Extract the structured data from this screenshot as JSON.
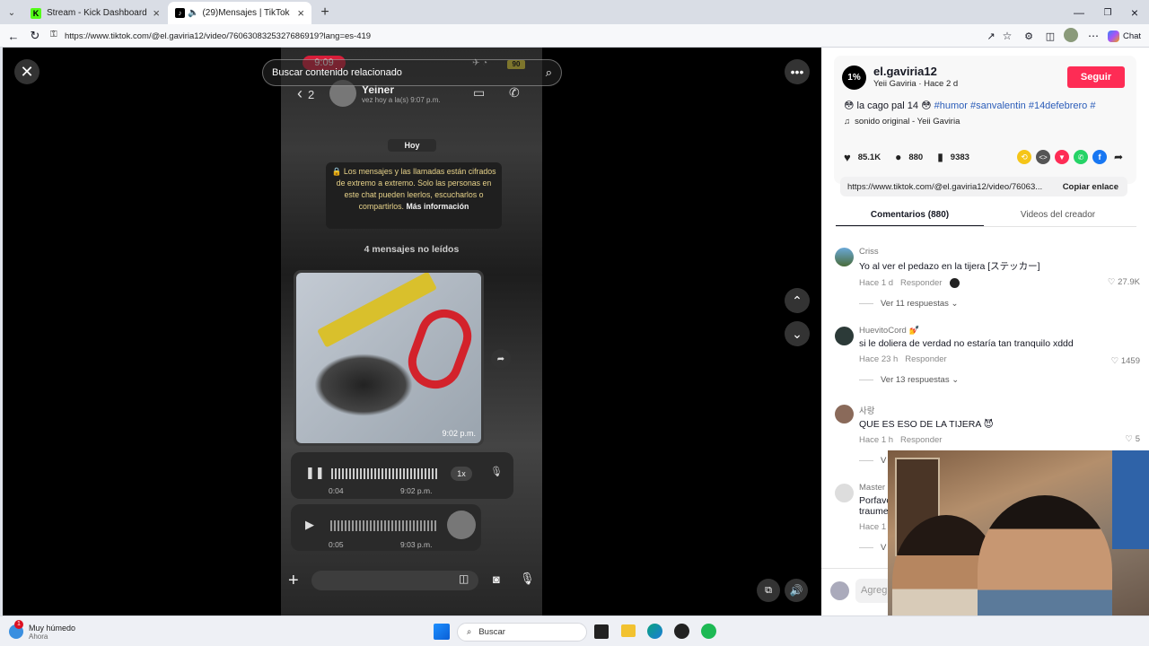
{
  "browser": {
    "tabs": [
      {
        "label": "Stream - Kick Dashboard",
        "active": false
      },
      {
        "label": "(29)Mensajes | TikTok",
        "active": true
      }
    ],
    "url": "https://www.tiktok.com/@el.gaviria12/video/7606308325327686919?lang=es-419",
    "chat_label": "Chat"
  },
  "player": {
    "search_placeholder": "Buscar contenido relacionado",
    "phone": {
      "time": "9:09",
      "battery": "90",
      "back_count": "2",
      "contact_name": "Yeiner",
      "contact_status": "vez hoy a la(s) 9:07 p.m.",
      "date_chip": "Hoy",
      "encryption_note": "Los mensajes y las llamadas están cifrados de extremo a extremo. Solo las personas en este chat pueden leerlos, escucharlos o compartirlos.",
      "encryption_link": "Más información",
      "unread": "4 mensajes no leídos",
      "image_time": "9:02 p.m.",
      "audio1": {
        "elapsed": "0:04",
        "time": "9:02 p.m.",
        "speed": "1x"
      },
      "audio2": {
        "elapsed": "0:05",
        "time": "9:03 p.m."
      }
    }
  },
  "post": {
    "avatar_text": "1%",
    "username": "el.gaviria12",
    "display_name": "Yeii Gaviria",
    "age": "Hace 2 d",
    "follow_label": "Seguir",
    "caption_text": "la cago pal 14",
    "hashtags": [
      "#humor",
      "#sanvalentin",
      "#14defebrero",
      "#"
    ],
    "sound": "sonido original - Yeii Gaviria",
    "likes": "85.1K",
    "comments_count": "880",
    "saves": "9383",
    "share_url": "https://www.tiktok.com/@el.gaviria12/video/76063...",
    "copy_label": "Copiar enlace",
    "tabs": [
      "Comentarios (880)",
      "Videos del creador"
    ],
    "comments": [
      {
        "user": "Criss",
        "text": "Yo al ver el pedazo en la tijera [ステッカー]",
        "age": "Hace 1 d",
        "reply": "Responder",
        "likes": "27.9K",
        "replies": "Ver 11 respuestas"
      },
      {
        "user": "HuevitoCord",
        "text": "si le doliera de verdad no estaría tan tranquilo xddd",
        "age": "Hace 23 h",
        "reply": "Responder",
        "likes": "1459",
        "replies": "Ver 13 respuestas"
      },
      {
        "user": "사랑",
        "text": "QUE ES ESO DE LA TIJERA",
        "age": "Hace 1 h",
        "reply": "Responder",
        "likes": "5",
        "replies": "V"
      },
      {
        "user": "Master",
        "text": "Porfavo",
        "text2": "traume",
        "age": "Hace 1 d",
        "reply": "",
        "likes": "",
        "replies": "V"
      }
    ],
    "add_comment_placeholder": "Agreg"
  },
  "taskbar": {
    "weather": "Muy húmedo",
    "weather_sub": "Ahora",
    "weather_badge": "1",
    "search": "Buscar"
  }
}
